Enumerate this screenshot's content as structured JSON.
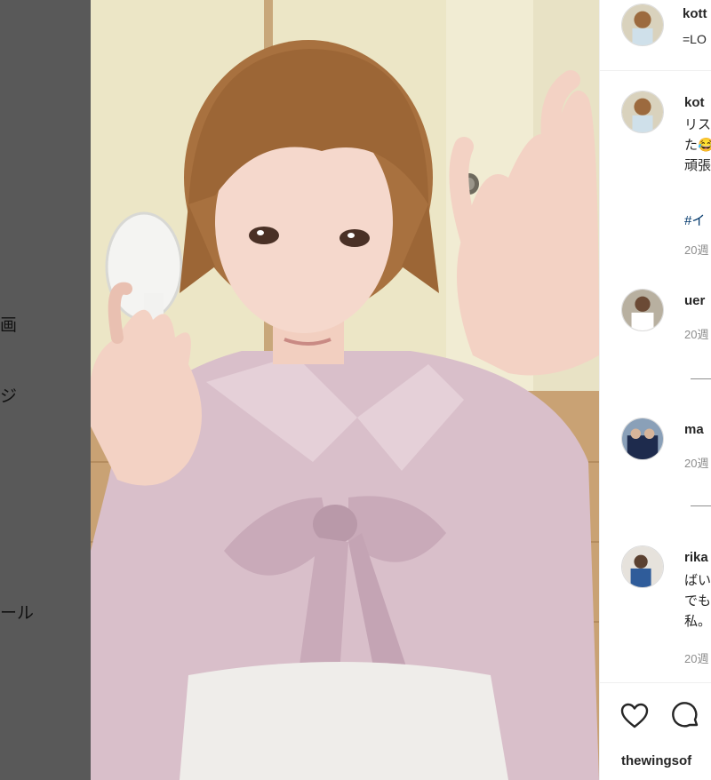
{
  "sidebar": {
    "item_video": "画",
    "item_message": "ジ",
    "item_profile": "ール"
  },
  "post": {
    "author_username": "kott",
    "author_subtitle": "=LO"
  },
  "caption": {
    "username": "kot",
    "lines": [
      "リス",
      "た😂",
      "頑張"
    ],
    "hashtag": "#イ",
    "time": "20週"
  },
  "comments": [
    {
      "username": "uer",
      "lines": [],
      "time": "20週"
    },
    {
      "username": "ma",
      "lines": [],
      "time": "20週"
    },
    {
      "username": "rika",
      "lines": [
        "ばい",
        "でも",
        "私。"
      ],
      "time": "20週"
    }
  ],
  "actions": {
    "like_icon": "heart-icon",
    "comment_icon": "comment-icon",
    "liked_by": "thewingsof"
  },
  "colors": {
    "backdrop": "#595959",
    "hashtag": "#00376b",
    "meta_text": "#8e8e8e",
    "blouse": "#d9bfca",
    "hair": "#a8713f"
  }
}
